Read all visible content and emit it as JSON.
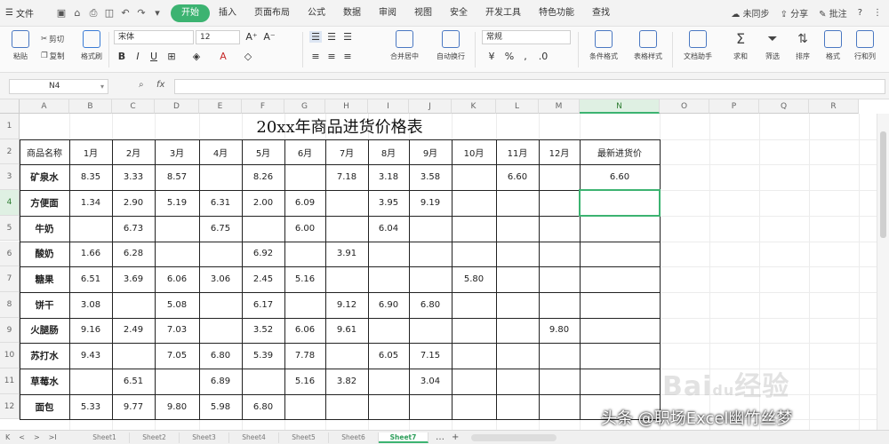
{
  "menubar": {
    "file_label": "文件",
    "tabs": [
      "开始",
      "插入",
      "页面布局",
      "公式",
      "数据",
      "审阅",
      "视图",
      "安全",
      "开发工具",
      "特色功能",
      "查找"
    ],
    "active_tab": "开始",
    "right": {
      "unsaved": "未同步",
      "share": "分享",
      "batch": "批注",
      "help": "?"
    }
  },
  "toolbar": {
    "paste": "粘贴",
    "cut": "剪切",
    "copy": "复制",
    "format_painter": "格式刷",
    "font_name": "宋体",
    "font_size": "12",
    "merge": "合并居中",
    "wrap": "自动换行",
    "number_format": "常规",
    "cond_format": "条件格式",
    "table_style": "表格样式",
    "doc_helper": "文档助手",
    "sum": "求和",
    "filter": "筛选",
    "sort": "排序",
    "format": "格式",
    "rows_cols": "行和列"
  },
  "formula_bar": {
    "cell_ref": "N4",
    "fx": "fx",
    "value": ""
  },
  "columns": [
    "A",
    "B",
    "C",
    "D",
    "E",
    "F",
    "G",
    "H",
    "I",
    "J",
    "K",
    "L",
    "M",
    "N",
    "O",
    "P",
    "Q",
    "R"
  ],
  "selected_col": "N",
  "selected_row": "4",
  "rows": [
    "1",
    "2",
    "3",
    "4",
    "5",
    "6",
    "7",
    "8",
    "9",
    "10",
    "11",
    "12"
  ],
  "sheet": {
    "title": "20xx年商品进货价格表",
    "headers": [
      "商品名称",
      "1月",
      "2月",
      "3月",
      "4月",
      "5月",
      "6月",
      "7月",
      "8月",
      "9月",
      "10月",
      "11月",
      "12月",
      "最新进货价"
    ],
    "rows": [
      [
        "矿泉水",
        "8.35",
        "3.33",
        "8.57",
        "",
        "8.26",
        "",
        "7.18",
        "3.18",
        "3.58",
        "",
        "6.60",
        "",
        "6.60"
      ],
      [
        "方便面",
        "1.34",
        "2.90",
        "5.19",
        "6.31",
        "2.00",
        "6.09",
        "",
        "3.95",
        "9.19",
        "",
        "",
        "",
        ""
      ],
      [
        "牛奶",
        "",
        "6.73",
        "",
        "6.75",
        "",
        "6.00",
        "",
        "6.04",
        "",
        "",
        "",
        "",
        ""
      ],
      [
        "酸奶",
        "1.66",
        "6.28",
        "",
        "",
        "6.92",
        "",
        "3.91",
        "",
        "",
        "",
        "",
        "",
        ""
      ],
      [
        "糖果",
        "6.51",
        "3.69",
        "6.06",
        "3.06",
        "2.45",
        "5.16",
        "",
        "",
        "",
        "5.80",
        "",
        "",
        ""
      ],
      [
        "饼干",
        "3.08",
        "",
        "5.08",
        "",
        "6.17",
        "",
        "9.12",
        "6.90",
        "6.80",
        "",
        "",
        "",
        ""
      ],
      [
        "火腿肠",
        "9.16",
        "2.49",
        "7.03",
        "",
        "3.52",
        "6.06",
        "9.61",
        "",
        "",
        "",
        "",
        "9.80",
        ""
      ],
      [
        "苏打水",
        "9.43",
        "",
        "7.05",
        "6.80",
        "5.39",
        "7.78",
        "",
        "6.05",
        "7.15",
        "",
        "",
        "",
        ""
      ],
      [
        "草莓水",
        "",
        "6.51",
        "",
        "6.89",
        "",
        "5.16",
        "3.82",
        "",
        "3.04",
        "",
        "",
        "",
        ""
      ],
      [
        "面包",
        "5.33",
        "9.77",
        "9.80",
        "5.98",
        "6.80",
        "",
        "",
        "",
        "",
        "",
        "",
        "",
        ""
      ]
    ]
  },
  "sheet_tabs": [
    "Sheet1",
    "Sheet2",
    "Sheet3",
    "Sheet4",
    "Sheet5",
    "Sheet6",
    "Sheet7"
  ],
  "active_sheet_tab": "Sheet7",
  "watermark": {
    "main": "Bai",
    "paw": "du",
    "sub": "经验"
  },
  "caption": "头条 @职场Excel幽竹丝梦",
  "colors": {
    "accent": "#3cb371",
    "active_tab_bg": "#3cb371"
  }
}
